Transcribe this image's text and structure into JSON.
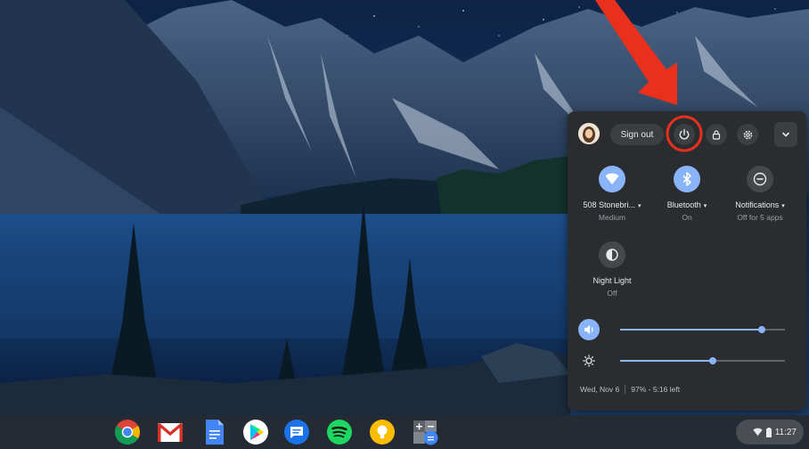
{
  "quick_settings": {
    "sign_out_label": "Sign out",
    "tiles": [
      {
        "label": "508 Stonebri...",
        "sub": "Medium",
        "state": "on",
        "icon": "wifi-icon"
      },
      {
        "label": "Bluetooth",
        "sub": "On",
        "state": "on",
        "icon": "bluetooth-icon"
      },
      {
        "label": "Notifications",
        "sub": "Off for 5 apps",
        "state": "off",
        "icon": "do-not-disturb-icon"
      },
      {
        "label": "Night Light",
        "sub": "Off",
        "state": "off",
        "icon": "night-light-icon"
      }
    ],
    "volume_level": 0.86,
    "brightness_level": 0.56,
    "date": "Wed, Nov 6",
    "battery": "97% - 5:16 left"
  },
  "shelf": {
    "apps": [
      "chrome-icon",
      "gmail-icon",
      "docs-icon",
      "play-store-icon",
      "messages-icon",
      "spotify-icon",
      "keep-icon",
      "calculator-icon"
    ],
    "time": "11:27"
  },
  "colors": {
    "accent": "#8ab4f8",
    "panel": "#2a2c30",
    "annotation": "#e8301c"
  }
}
